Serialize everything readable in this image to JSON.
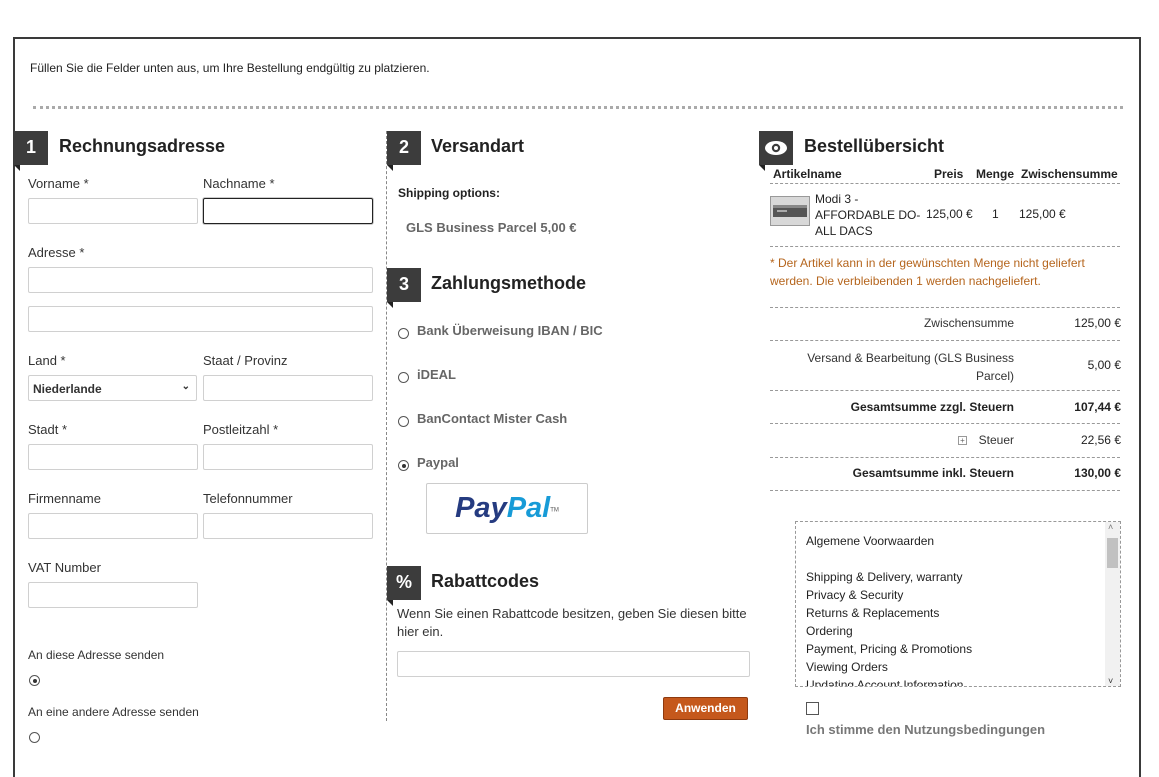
{
  "intro_text": "Füllen Sie die Felder unten aus, um Ihre Bestellung endgültig zu platzieren.",
  "billing": {
    "number": "1",
    "title": "Rechnungsadresse",
    "firstname_label": "Vorname",
    "lastname_label": "Nachname",
    "address_label": "Adresse",
    "country_label": "Land",
    "country_value": "Niederlande",
    "state_label": "Staat / Provinz",
    "city_label": "Stadt",
    "zip_label": "Postleitzahl",
    "company_label": "Firmenname",
    "phone_label": "Telefonnummer",
    "vat_label": "VAT Number",
    "required_mark": "*",
    "ship_same_label": "An diese Adresse senden",
    "ship_other_label": "An eine andere Adresse senden"
  },
  "shipping": {
    "number": "2",
    "title": "Versandart",
    "options_label": "Shipping options:",
    "option": "GLS Business Parcel 5,00 €"
  },
  "payment": {
    "number": "3",
    "title": "Zahlungsmethode",
    "methods": [
      "Bank Überweisung IBAN / BIC",
      "iDEAL",
      "BanContact Mister Cash",
      "Paypal"
    ],
    "selected": "Paypal",
    "paypal_logo_a": "Pay",
    "paypal_logo_b": "Pal",
    "paypal_tm": "TM"
  },
  "coupon": {
    "symbol": "%",
    "title": "Rabattcodes",
    "text": "Wenn Sie einen Rabattcode besitzen, geben Sie diesen bitte hier ein.",
    "button": "Anwenden"
  },
  "summary": {
    "title": "Bestellübersicht",
    "headers": {
      "name": "Artikelname",
      "price": "Preis",
      "qty": "Menge",
      "subtotal": "Zwischensumme"
    },
    "item": {
      "name_line1": "Modi 3 -",
      "name_line2": "AFFORDABLE DO-",
      "name_line3": "ALL DACS",
      "price": "125,00 €",
      "qty": "1",
      "subtotal": "125,00 €"
    },
    "stock_note": "* Der Artikel kann in der gewünschten Menge nicht geliefert werden. Die verbleibenden 1 werden nachgeliefert.",
    "totals": {
      "subtotal_label": "Zwischensumme",
      "subtotal_value": "125,00 €",
      "shipping_label_1": "Versand & Bearbeitung (GLS Business",
      "shipping_label_2": "Parcel)",
      "shipping_value": "5,00 €",
      "gross_ex_label": "Gesamtsumme zzgl. Steuern",
      "gross_ex_value": "107,44 €",
      "tax_label": "Steuer",
      "tax_value": "22,56 €",
      "gross_in_label": "Gesamtsumme inkl. Steuern",
      "gross_in_value": "130,00 €"
    },
    "terms_lines": [
      "Algemene Voorwaarden",
      "",
      "Shipping & Delivery, warranty",
      "Privacy & Security",
      "Returns & Replacements",
      "Ordering",
      "Payment, Pricing & Promotions",
      "Viewing Orders",
      "Updating Account Information"
    ],
    "agree_label": "Ich stimme den Nutzungsbedingungen"
  },
  "colors": {
    "badge": "#3c3c3c",
    "button": "#c5581c",
    "note": "#b5651d",
    "paypal_dark": "#253b80",
    "paypal_light": "#179bd7"
  }
}
